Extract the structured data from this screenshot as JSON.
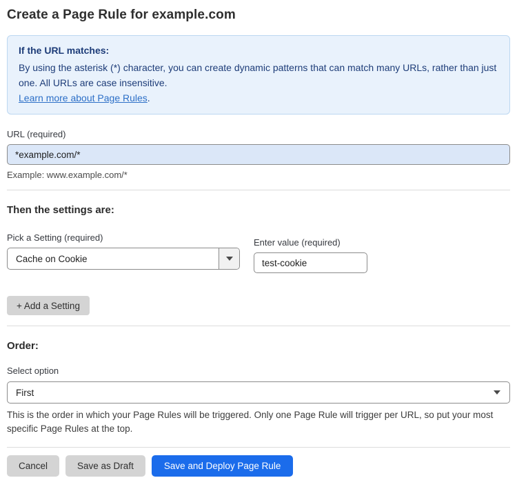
{
  "page": {
    "title": "Create a Page Rule for example.com"
  },
  "info_box": {
    "heading": "If the URL matches:",
    "body": "By using the asterisk (*) character, you can create dynamic patterns that can match many URLs, rather than just one. All URLs are case insensitive.",
    "link": "Learn more about Page Rules",
    "link_suffix": "."
  },
  "url_field": {
    "label": "URL (required)",
    "value": "*example.com/*",
    "example": "Example: www.example.com/*"
  },
  "settings": {
    "heading": "Then the settings are:",
    "setting_label": "Pick a Setting (required)",
    "setting_value": "Cache on Cookie",
    "value_label": "Enter value (required)",
    "value_text": "test-cookie",
    "add_button": "+ Add a Setting"
  },
  "order": {
    "heading": "Order:",
    "label": "Select option",
    "value": "First",
    "help": "This is the order in which your Page Rules will be triggered. Only one Page Rule will trigger per URL, so put your most specific Page Rules at the top."
  },
  "actions": {
    "cancel": "Cancel",
    "save_draft": "Save as Draft",
    "save_deploy": "Save and Deploy Page Rule"
  },
  "colors": {
    "accent_blue": "#1b6ceb",
    "info_bg": "#e9f2fc",
    "info_border": "#bcd7f1",
    "info_text": "#1d3c78",
    "link_blue": "#2c6fc7",
    "url_input_bg": "#dbe7f8",
    "button_gray": "#d4d4d4"
  }
}
